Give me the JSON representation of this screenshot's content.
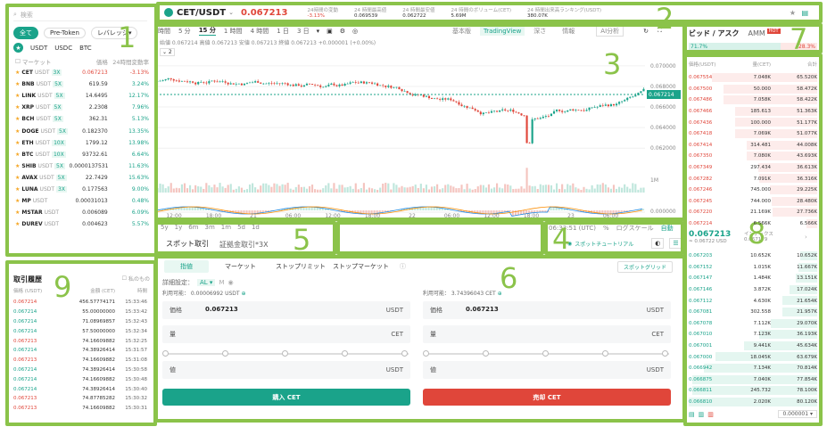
{
  "search": {
    "placeholder": "検索"
  },
  "market_tabs": [
    "全て",
    "Pre-Token",
    "レバレッジ"
  ],
  "quote_tabs": [
    "USDT",
    "USDC",
    "BTC"
  ],
  "market_head": {
    "name": "マーケット",
    "price": "価格",
    "change": "24時間変動率"
  },
  "markets": [
    {
      "sym": "CET",
      "quote": "USDT",
      "lev": "3X",
      "price": "0.067213",
      "chg": "-3.13%",
      "up": false
    },
    {
      "sym": "BNB",
      "quote": "USDT",
      "lev": "5X",
      "price": "619.59",
      "chg": "3.24%",
      "up": true
    },
    {
      "sym": "LINK",
      "quote": "USDT",
      "lev": "5X",
      "price": "14.6495",
      "chg": "12.17%",
      "up": true
    },
    {
      "sym": "XRP",
      "quote": "USDT",
      "lev": "5X",
      "price": "2.2308",
      "chg": "7.96%",
      "up": true
    },
    {
      "sym": "BCH",
      "quote": "USDT",
      "lev": "5X",
      "price": "362.31",
      "chg": "5.13%",
      "up": true
    },
    {
      "sym": "DOGE",
      "quote": "USDT",
      "lev": "5X",
      "price": "0.182370",
      "chg": "13.35%",
      "up": true
    },
    {
      "sym": "ETH",
      "quote": "USDT",
      "lev": "10X",
      "price": "1799.12",
      "chg": "13.98%",
      "up": true
    },
    {
      "sym": "BTC",
      "quote": "USDT",
      "lev": "10X",
      "price": "93732.61",
      "chg": "6.64%",
      "up": true
    },
    {
      "sym": "SHIB",
      "quote": "USDT",
      "lev": "5X",
      "price": "0.0000137531",
      "chg": "11.63%",
      "up": true
    },
    {
      "sym": "AVAX",
      "quote": "USDT",
      "lev": "5X",
      "price": "22.7429",
      "chg": "15.63%",
      "up": true
    },
    {
      "sym": "LUNA",
      "quote": "USDT",
      "lev": "3X",
      "price": "0.177563",
      "chg": "9.00%",
      "up": true
    },
    {
      "sym": "MP",
      "quote": "USDT",
      "lev": "",
      "price": "0.00031013",
      "chg": "0.48%",
      "up": true
    },
    {
      "sym": "MSTAR",
      "quote": "USDT",
      "lev": "",
      "price": "0.006089",
      "chg": "6.09%",
      "up": true
    },
    {
      "sym": "DUREV",
      "quote": "USDT",
      "lev": "",
      "price": "0.004623",
      "chg": "5.57%",
      "up": true
    }
  ],
  "header": {
    "pair": "CET/USDT",
    "price": "0.067213",
    "stats": [
      {
        "label": "24時間の変動",
        "value": "-3.13%"
      },
      {
        "label": "24 時間最高値",
        "value": "0.069539"
      },
      {
        "label": "24 時間最安値",
        "value": "0.062722"
      },
      {
        "label": "24 時間のボリューム(CET)",
        "value": "5.69M"
      },
      {
        "label": "24 時間出来高ランキング(USDT)",
        "value": "380.07K"
      }
    ]
  },
  "chart": {
    "intervals": [
      "時間",
      "5 分",
      "15 分",
      "1 時間",
      "4 時間",
      "1 日",
      "3 日"
    ],
    "active_interval": "15 分",
    "views": [
      "基本版",
      "TradingView",
      "深さ"
    ],
    "tools": [
      "情報",
      "AI分析"
    ],
    "ohlc": "始値 0.067214  高値 0.067213  安値 0.067213  終値 0.067213  +0.000001 (+0.00%)",
    "y_ticks": [
      "0.070000",
      "0.068000",
      "0.066000",
      "0.064000",
      "0.062000"
    ],
    "last_price_tag": "0.067214",
    "vol_tick": "1M",
    "macd_tick": "0.000000",
    "x_ticks": [
      "12:00",
      "18:00",
      "21",
      "06:00",
      "12:00",
      "18:00",
      "22",
      "06:00",
      "12:00",
      "18:00",
      "23",
      "06:00"
    ],
    "ranges": [
      "5y",
      "1y",
      "6m",
      "3m",
      "1m",
      "5d",
      "1d"
    ],
    "time": "06:33:51 (UTC)",
    "scale": [
      "%",
      "ログスケール",
      "自動"
    ]
  },
  "trade_tabs": {
    "spot": "スポット取引",
    "margin": "証拠金取引*3X"
  },
  "tutorial": "スポットチュートリアル",
  "order_types": [
    "指値",
    "マーケット",
    "ストップリミット",
    "ストップマーケット"
  ],
  "spot_grid": "スポットグリッド",
  "order": {
    "detail_label": "詳細設定：",
    "detail_value": "AL",
    "avail_buy": "利用可能： 0.00006992 USDT",
    "avail_sell": "利用可能： 3.74396043 CET",
    "price_label": "価格",
    "price_value": "0.067213",
    "qty_label": "量",
    "total_label": "値",
    "buy_label": "購入 CET",
    "sell_label": "売却 CET"
  },
  "trades": {
    "title": "取引履歴",
    "mine": "私のもの",
    "cols": [
      "価格 (USDT)",
      "金額 (CET)",
      "時間"
    ],
    "rows": [
      [
        "0.067214",
        "456.57774171",
        "15:33:46",
        false
      ],
      [
        "0.067214",
        "55.00000000",
        "15:33:42",
        true
      ],
      [
        "0.067214",
        "71.08969857",
        "15:32:43",
        true
      ],
      [
        "0.067214",
        "57.50000000",
        "15:32:34",
        true
      ],
      [
        "0.067213",
        "74.16609882",
        "15:32:25",
        false
      ],
      [
        "0.067214",
        "74.38926414",
        "15:31:57",
        true
      ],
      [
        "0.067213",
        "74.16609882",
        "15:31:08",
        false
      ],
      [
        "0.067214",
        "74.38926414",
        "15:30:58",
        true
      ],
      [
        "0.067214",
        "74.16609882",
        "15:30:48",
        true
      ],
      [
        "0.067214",
        "74.38926414",
        "15:30:40",
        true
      ],
      [
        "0.067213",
        "74.87785282",
        "15:30:32",
        false
      ],
      [
        "0.067213",
        "74.16609882",
        "15:30:31",
        false
      ]
    ]
  },
  "book": {
    "tab": "ビッド / アスク",
    "amm": "AMM",
    "hot": "HOT",
    "bid_pct": "71.7%",
    "ask_pct": "28.3%",
    "cols": [
      "価格(USDT)",
      "量(CET)",
      "合計"
    ],
    "asks": [
      [
        "0.067554",
        "7.048K",
        "65.520K"
      ],
      [
        "0.067500",
        "50.000",
        "58.472K"
      ],
      [
        "0.067486",
        "7.058K",
        "58.422K"
      ],
      [
        "0.067466",
        "185.613",
        "51.363K"
      ],
      [
        "0.067436",
        "100.000",
        "51.177K"
      ],
      [
        "0.067418",
        "7.069K",
        "51.077K"
      ],
      [
        "0.067414",
        "314.481",
        "44.008K"
      ],
      [
        "0.067350",
        "7.080K",
        "43.693K"
      ],
      [
        "0.067349",
        "297.434",
        "36.613K"
      ],
      [
        "0.067282",
        "7.091K",
        "36.316K"
      ],
      [
        "0.067246",
        "745.000",
        "29.225K"
      ],
      [
        "0.067245",
        "744.000",
        "28.480K"
      ],
      [
        "0.067220",
        "21.169K",
        "27.736K"
      ],
      [
        "0.067214",
        "6.566K",
        "6.566K"
      ]
    ],
    "mid_price": "0.067213",
    "mid_usd": "≈ 0.06722 USD",
    "index_label": "インデックス",
    "index_value": "0.067179",
    "bids": [
      [
        "0.067203",
        "10.652K",
        "10.652K"
      ],
      [
        "0.067152",
        "1.015K",
        "11.667K"
      ],
      [
        "0.067147",
        "1.484K",
        "13.151K"
      ],
      [
        "0.067146",
        "3.872K",
        "17.024K"
      ],
      [
        "0.067112",
        "4.630K",
        "21.654K"
      ],
      [
        "0.067081",
        "302.558",
        "21.957K"
      ],
      [
        "0.067078",
        "7.112K",
        "29.070K"
      ],
      [
        "0.067010",
        "7.123K",
        "36.193K"
      ],
      [
        "0.067001",
        "9.441K",
        "45.634K"
      ],
      [
        "0.067000",
        "18.045K",
        "63.679K"
      ],
      [
        "0.066942",
        "7.134K",
        "70.814K"
      ],
      [
        "0.066875",
        "7.040K",
        "77.854K"
      ],
      [
        "0.066811",
        "245.732",
        "78.100K"
      ],
      [
        "0.066810",
        "2.020K",
        "80.120K"
      ]
    ],
    "precision": "0.000001"
  },
  "annotations": [
    "1",
    "2",
    "3",
    "4",
    "5",
    "6",
    "7",
    "8",
    "9"
  ]
}
